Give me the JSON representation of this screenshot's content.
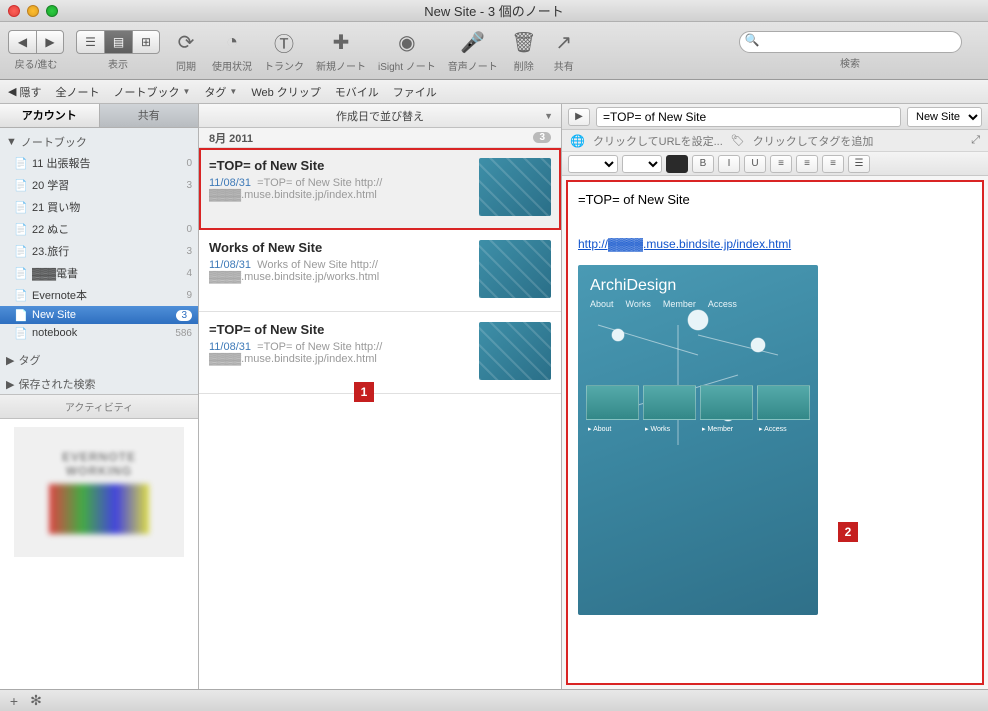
{
  "window": {
    "title": "New Site - 3 個のノート"
  },
  "toolbar": {
    "nav_label": "戻る/進む",
    "view_label": "表示",
    "sync_label": "同期",
    "usage_label": "使用状況",
    "trunk_label": "トランク",
    "newnote_label": "新規ノート",
    "isight_label": "iSight ノート",
    "audio_label": "音声ノート",
    "delete_label": "削除",
    "share_label": "共有",
    "search_label": "検索",
    "search_placeholder": ""
  },
  "filterbar": {
    "hide": "隠す",
    "all_notes": "全ノート",
    "notebooks": "ノートブック",
    "tags": "タグ",
    "webclip": "Web クリップ",
    "mobile": "モバイル",
    "file": "ファイル"
  },
  "sidebar": {
    "tabs": {
      "account": "アカウント",
      "shared": "共有"
    },
    "section_notebooks": "ノートブック",
    "items": [
      {
        "label": "11 出張報告",
        "count": "0"
      },
      {
        "label": "20 学習",
        "count": "3"
      },
      {
        "label": "21 買い物",
        "count": ""
      },
      {
        "label": "22 ぬこ",
        "count": "0"
      },
      {
        "label": "23.旅行",
        "count": "3"
      },
      {
        "label": "▓▓▓電書",
        "count": "4"
      },
      {
        "label": "Evernote本",
        "count": "9"
      },
      {
        "label": "New Site",
        "count": "3"
      },
      {
        "label": "notebook",
        "count": "586"
      }
    ],
    "section_tags": "タグ",
    "section_saved": "保存された検索",
    "activity": "アクティビティ",
    "thumb_line1": "EVERNOTE",
    "thumb_line2": "WORKING"
  },
  "notelist": {
    "sort_label": "作成日で並び替え",
    "date_header": "8月 2011",
    "date_count": "3",
    "items": [
      {
        "title": "=TOP= of New Site",
        "date": "11/08/31",
        "snippet": "=TOP= of New Site http://",
        "url": "▓▓▓▓.muse.bindsite.jp/index.html",
        "selected": true
      },
      {
        "title": "Works of New Site",
        "date": "11/08/31",
        "snippet": "Works of New Site http://",
        "url": "▓▓▓▓.muse.bindsite.jp/works.html",
        "selected": false
      },
      {
        "title": "=TOP= of New Site",
        "date": "11/08/31",
        "snippet": "=TOP= of New Site http://",
        "url": "▓▓▓▓.muse.bindsite.jp/index.html",
        "selected": false
      }
    ]
  },
  "detail": {
    "title_value": "=TOP= of New Site",
    "notebook_select": "New Site",
    "url_prompt": "クリックしてURLを設定...",
    "tag_prompt": "クリックしてタグを追加",
    "content_title": "=TOP= of New Site",
    "content_link": "http://▓▓▓▓.muse.bindsite.jp/index.html",
    "preview": {
      "logo_a": "Archi",
      "logo_b": "Design",
      "nav": [
        "About",
        "Works",
        "Member",
        "Access"
      ],
      "cards": [
        "About",
        "Works",
        "Member",
        "Access"
      ]
    }
  },
  "callouts": {
    "one": "1",
    "two": "2"
  }
}
